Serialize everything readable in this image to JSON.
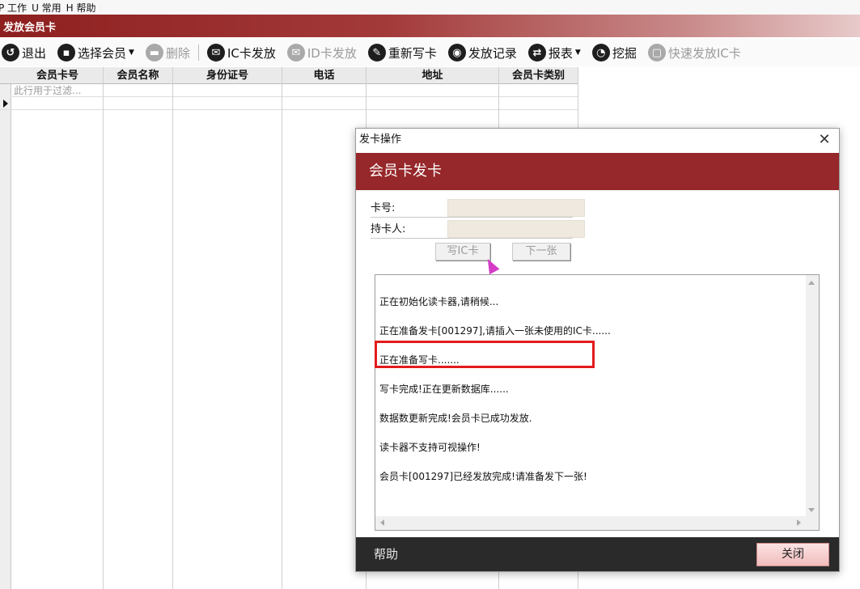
{
  "menubar": {
    "items": [
      "P 工作",
      "U 常用",
      "H 帮助"
    ]
  },
  "window": {
    "title": "发放会员卡"
  },
  "toolbar": {
    "items": [
      {
        "label": "退出",
        "icon": "exit-icon",
        "glyph": "↺",
        "disabled": false,
        "dropdown": false
      },
      {
        "label": "选择会员",
        "icon": "document-icon",
        "glyph": "▪",
        "disabled": false,
        "dropdown": true
      },
      {
        "label": "删除",
        "icon": "trash-icon",
        "glyph": "▬",
        "disabled": true,
        "dropdown": false
      },
      {
        "label": "IC卡发放",
        "icon": "mail-icon",
        "glyph": "✉",
        "disabled": false,
        "dropdown": false
      },
      {
        "label": "ID卡发放",
        "icon": "mail-icon",
        "glyph": "✉",
        "disabled": true,
        "dropdown": false
      },
      {
        "label": "重新写卡",
        "icon": "rewrite-icon",
        "glyph": "✎",
        "disabled": false,
        "dropdown": false
      },
      {
        "label": "发放记录",
        "icon": "eye-icon",
        "glyph": "◉",
        "disabled": false,
        "dropdown": false
      },
      {
        "label": "报表",
        "icon": "report-icon",
        "glyph": "⇄",
        "disabled": false,
        "dropdown": true
      },
      {
        "label": "挖掘",
        "icon": "chart-icon",
        "glyph": "◔",
        "disabled": false,
        "dropdown": false
      },
      {
        "label": "快速发放IC卡",
        "icon": "card-icon",
        "glyph": "▢",
        "disabled": true,
        "dropdown": false
      }
    ]
  },
  "grid": {
    "columns": [
      "会员卡号",
      "会员名称",
      "身份证号",
      "电话",
      "地址",
      "会员卡类别"
    ],
    "filter_placeholder": "此行用于过滤..."
  },
  "dialog": {
    "title": "发卡操作",
    "header": "会员卡发卡",
    "card_no_label": "卡号:",
    "card_no_value": "",
    "holder_label": "持卡人:",
    "holder_value": "",
    "write_button": "写IC卡",
    "next_button": "下一张",
    "log_lines": [
      "正在初始化读卡器,请稍候...",
      "正在准备发卡[001297],请插入一张未使用的IC卡......",
      "正在准备写卡.......",
      "写卡完成!正在更新数据库......",
      "数据数更新完成!会员卡已成功发放.",
      "读卡器不支持可视操作!",
      "会员卡[001297]已经发放完成!请准备发下一张!"
    ],
    "help_label": "帮助",
    "close_label": "关闭"
  },
  "colors": {
    "accent": "#96272a",
    "highlight": "#e31b1b",
    "footer": "#2a2a2a"
  }
}
